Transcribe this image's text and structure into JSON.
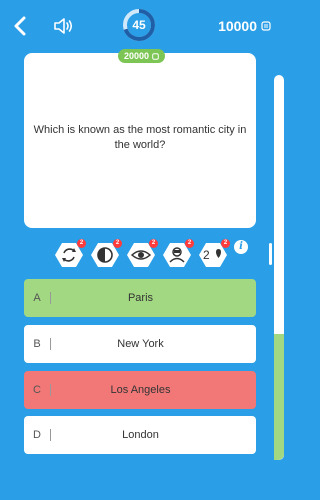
{
  "header": {
    "timer": "45",
    "timer_progress": 0.7,
    "coins": "10000",
    "reward": "20000"
  },
  "question": {
    "text": "Which is known as the most romantic city in the world?"
  },
  "lifelines": [
    {
      "name": "swap-question",
      "icon": "refresh-icon",
      "count": "2"
    },
    {
      "name": "fifty-fifty",
      "icon": "half-circle-icon",
      "count": "2"
    },
    {
      "name": "reveal-answer",
      "icon": "eye-icon",
      "count": "2"
    },
    {
      "name": "audience-poll",
      "icon": "audience-icon",
      "count": "2"
    },
    {
      "name": "second-chance",
      "icon": "heart-icon",
      "label": "2",
      "count": "2"
    }
  ],
  "answers": [
    {
      "letter": "A",
      "text": "Paris",
      "state": "correct",
      "color": "#a2d882"
    },
    {
      "letter": "B",
      "text": "New York",
      "state": "neutral",
      "color": "#ffffff"
    },
    {
      "letter": "C",
      "text": "Los Angeles",
      "state": "wrong",
      "color": "#f27878"
    },
    {
      "letter": "D",
      "text": "London",
      "state": "neutral",
      "color": "#ffffff"
    }
  ],
  "colors": {
    "background": "#2a9ee6",
    "correct": "#a2d882",
    "wrong": "#f27878",
    "reward": "#7dc655"
  }
}
